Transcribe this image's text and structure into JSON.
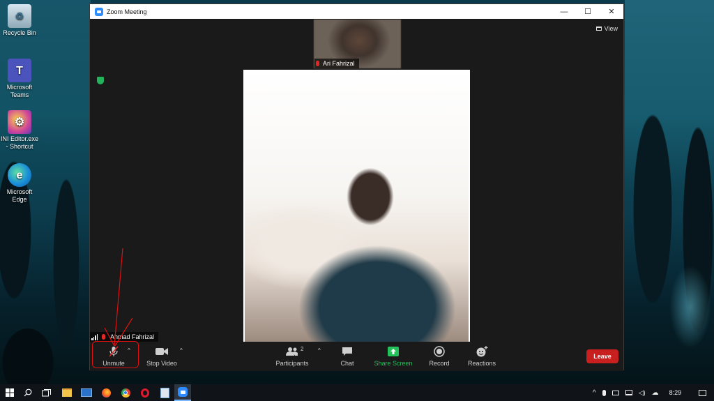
{
  "desktop": {
    "icons": [
      {
        "label": "Recycle Bin",
        "icon": "recycle-bin-icon"
      },
      {
        "label": "Microsoft Teams",
        "icon": "teams-icon"
      },
      {
        "label": "INI Editor.exe - Shortcut",
        "icon": "ini-editor-icon"
      },
      {
        "label": "Microsoft Edge",
        "icon": "edge-icon"
      }
    ]
  },
  "window": {
    "title": "Zoom Meeting",
    "controls": {
      "minimize": "—",
      "maximize": "☐",
      "close": "✕"
    }
  },
  "meeting": {
    "view_label": "View",
    "thumbnail_participant": "Ari Fahrizal",
    "self_name": "Ahmad Fahrizal"
  },
  "toolbar": {
    "unmute": "Unmute",
    "stop_video": "Stop Video",
    "participants": "Participants",
    "participants_count": "2",
    "chat": "Chat",
    "share_screen": "Share Screen",
    "record": "Record",
    "reactions": "Reactions",
    "leave": "Leave"
  },
  "colors": {
    "share_green": "#23c05b",
    "leave_red": "#c81f1f",
    "annotation_red": "#e01010",
    "zoom_blue": "#2d8cff"
  },
  "taskbar": {
    "clock": "8:29",
    "apps": [
      "start-icon",
      "search-icon",
      "task-view-icon",
      "file-explorer-icon",
      "mail-icon",
      "firefox-icon",
      "chrome-icon",
      "opera-icon",
      "ini-editor-icon",
      "zoom-icon"
    ]
  }
}
